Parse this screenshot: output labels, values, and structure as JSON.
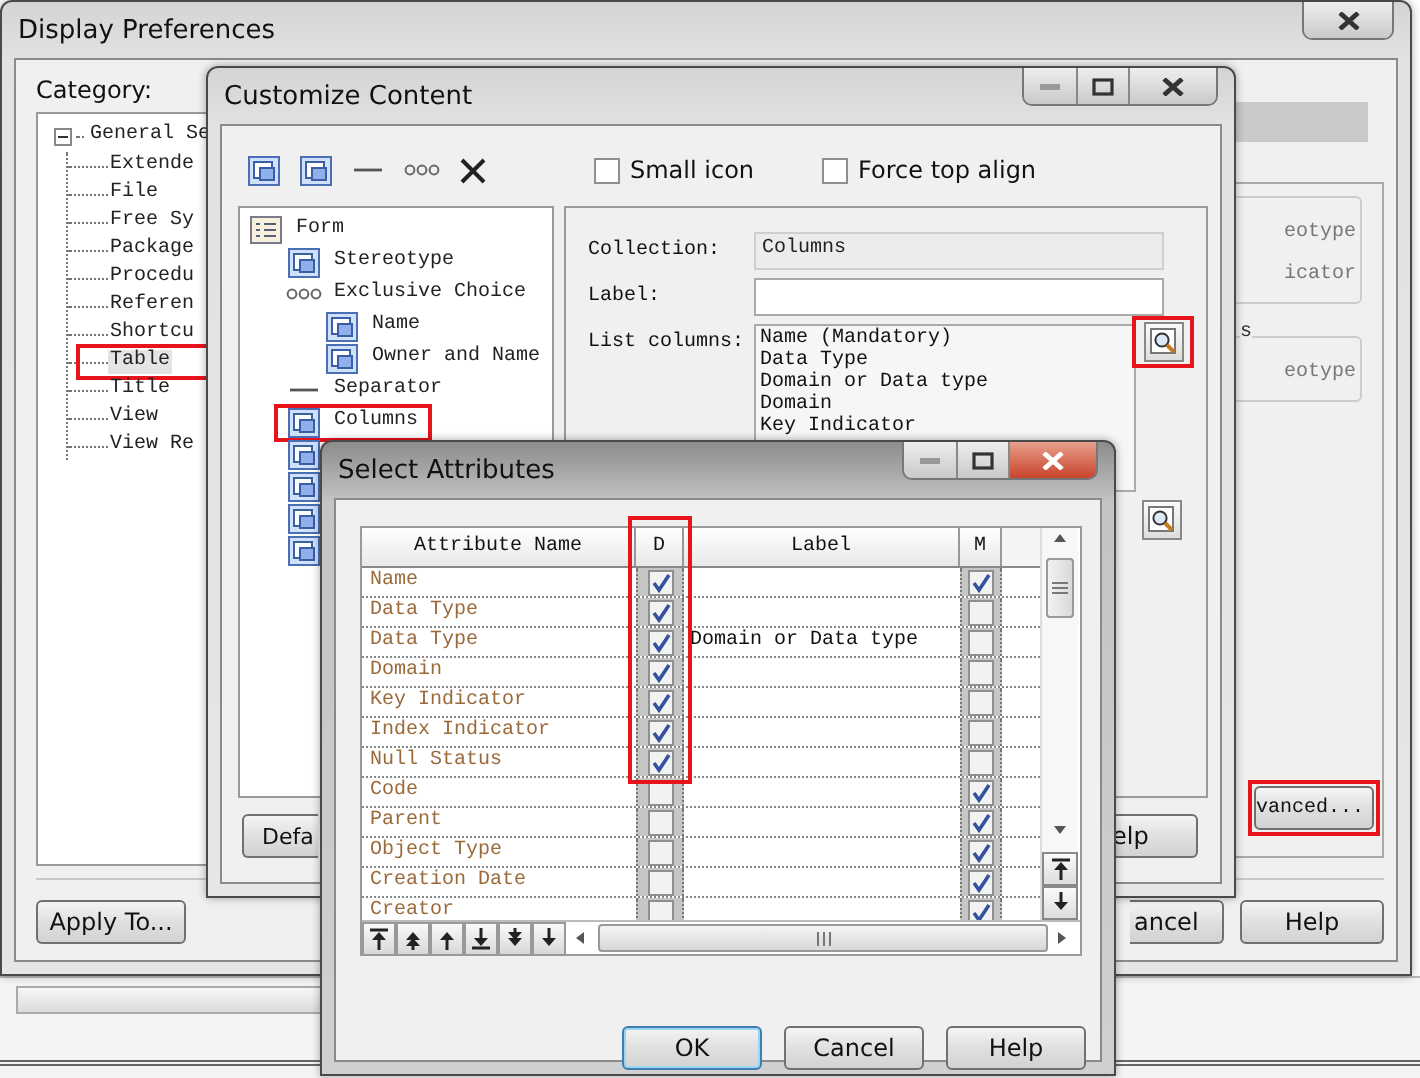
{
  "display_preferences": {
    "title": "Display Preferences",
    "category_label": "Category:",
    "tree": {
      "label": "General Se",
      "expanded": true,
      "children": [
        {
          "label": "Extende",
          "selected": false
        },
        {
          "label": "File",
          "selected": false
        },
        {
          "label": "Free Sy",
          "selected": false
        },
        {
          "label": "Package",
          "selected": false
        },
        {
          "label": "Procedu",
          "selected": false
        },
        {
          "label": "Referen",
          "selected": false
        },
        {
          "label": "Shortcu",
          "selected": false
        },
        {
          "label": "Table",
          "selected": true,
          "highlighted": true
        },
        {
          "label": "Title",
          "selected": false
        },
        {
          "label": "View",
          "selected": false
        },
        {
          "label": "View Re",
          "selected": false
        }
      ]
    },
    "groups": [
      {
        "items": [
          "eotype",
          "icator"
        ]
      },
      {
        "title": "s",
        "items": [
          "eotype"
        ]
      }
    ],
    "advanced_button": {
      "label": "vanced...",
      "highlighted": true
    },
    "buttons": [
      "Apply To...",
      "ancel",
      "Help"
    ]
  },
  "customize_content": {
    "title": "Customize Content",
    "options": [
      {
        "label": "Small icon",
        "checked": false
      },
      {
        "label": "Force top align",
        "checked": false
      }
    ],
    "tree": [
      {
        "kind": "form",
        "label": "Form",
        "children": [
          {
            "kind": "attribute",
            "label": "Stereotype"
          },
          {
            "kind": "choice",
            "label": "Exclusive Choice",
            "children": [
              {
                "kind": "attribute",
                "label": "Name"
              },
              {
                "kind": "attribute",
                "label": "Owner and Name"
              }
            ]
          },
          {
            "kind": "separator",
            "label": "Separator"
          },
          {
            "kind": "attribute",
            "label": "Columns",
            "highlighted": true
          },
          {
            "kind": "attribute"
          },
          {
            "kind": "attribute"
          },
          {
            "kind": "attribute"
          },
          {
            "kind": "attribute"
          }
        ]
      }
    ],
    "collection_label": "Collection:",
    "collection": "Columns",
    "label_label": "Label:",
    "list_columns_label": "List columns:",
    "list_columns": [
      "Name (Mandatory)",
      "Data Type",
      "Domain or Data type",
      "Domain",
      "Key Indicator"
    ],
    "browse_buttons": [
      {
        "highlighted": true
      },
      {
        "highlighted": false
      }
    ],
    "buttons": [
      "Defa",
      "elp"
    ]
  },
  "select_attributes": {
    "title": "Select Attributes",
    "columns": [
      {
        "label": "Attribute Name"
      },
      {
        "label": "D",
        "highlighted": true
      },
      {
        "label": "Label"
      },
      {
        "label": "M"
      }
    ],
    "rows": [
      {
        "name": "Name",
        "d": true,
        "m": true
      },
      {
        "name": "Data Type",
        "d": true,
        "m": false
      },
      {
        "name": "Data Type",
        "d": true,
        "label": "Domain or Data type",
        "m": false
      },
      {
        "name": "Domain",
        "d": true,
        "m": false
      },
      {
        "name": "Key Indicator",
        "d": true,
        "m": false
      },
      {
        "name": "Index Indicator",
        "d": true,
        "m": false
      },
      {
        "name": "Null Status",
        "d": true,
        "m": false
      },
      {
        "name": "Code",
        "d": false,
        "m": true
      },
      {
        "name": "Parent",
        "d": false,
        "m": true
      },
      {
        "name": "Object Type",
        "d": false,
        "m": true
      },
      {
        "name": "Creation Date",
        "d": false,
        "m": true
      },
      {
        "name": "Creator",
        "d": false,
        "m": true
      }
    ],
    "buttons": [
      {
        "label": "OK",
        "default": true
      },
      {
        "label": "Cancel",
        "default": false
      },
      {
        "label": "Help",
        "default": false
      }
    ]
  }
}
